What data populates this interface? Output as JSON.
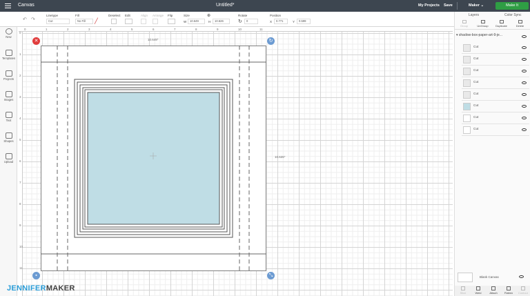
{
  "app": {
    "title": "Canvas",
    "document_title": "Untitled*",
    "my_projects": "My Projects",
    "save": "Save",
    "machine": "Maker",
    "make_button": "Make It"
  },
  "toolbar": {
    "linetype_label": "Linetype",
    "linetype_value": "Cut",
    "fill_label": "Fill",
    "fill_value": "No Fill",
    "deselect_label": "Deselect",
    "edit_label": "Edit",
    "align_label": "Align",
    "arrange_label": "Arrange",
    "flip_label": "Flip",
    "size_label": "Size",
    "size_w_label": "W",
    "size_w": "10.649",
    "size_h_label": "H",
    "size_h": "10.626",
    "rotate_label": "Rotate",
    "rotate_value": "0",
    "position_label": "Position",
    "pos_x_label": "X",
    "pos_x": "0.771",
    "pos_y_label": "Y",
    "pos_y": "0.599"
  },
  "left_sidebar": [
    {
      "label": "New"
    },
    {
      "label": "Templates"
    },
    {
      "label": "Projects"
    },
    {
      "label": "Images"
    },
    {
      "label": "Text"
    },
    {
      "label": "Shapes"
    },
    {
      "label": "Upload"
    }
  ],
  "ruler": {
    "top": [
      "0",
      "1",
      "2",
      "3",
      "4",
      "5",
      "6",
      "7",
      "8",
      "9",
      "10",
      "11"
    ],
    "left": [
      "0",
      "1",
      "2",
      "3",
      "4",
      "5",
      "6",
      "7",
      "8",
      "9",
      "10",
      "11"
    ]
  },
  "canvas": {
    "width_label": "10.649\"",
    "height_label": "10.626\"",
    "inner_fill": "#bfdde5"
  },
  "layers_panel": {
    "tabs": [
      "Layers",
      "Color Sync"
    ],
    "actions": [
      "Group",
      "UnGroup",
      "Duplicate",
      "Delete"
    ],
    "group_name": "shadow-box-paper-art-9-je...",
    "layers": [
      {
        "label": "Cut",
        "color": "#e9e9e9"
      },
      {
        "label": "Cut",
        "color": "#e9e9e9"
      },
      {
        "label": "Cut",
        "color": "#e9e9e9"
      },
      {
        "label": "Cut",
        "color": "#e9e9e9"
      },
      {
        "label": "Cut",
        "color": "#e9e9e9"
      },
      {
        "label": "Cut",
        "color": "#bfdde5"
      },
      {
        "label": "Cut",
        "color": "#ffffff"
      },
      {
        "label": "Cut",
        "color": "#ffffff"
      }
    ],
    "blank_canvas": "Blank Canvas",
    "bottom_actions": [
      "Slice",
      "Weld",
      "Attach",
      "Flatten",
      "Contour"
    ]
  },
  "branding": {
    "part1": "JENNIFER",
    "part2": "MAKER"
  }
}
